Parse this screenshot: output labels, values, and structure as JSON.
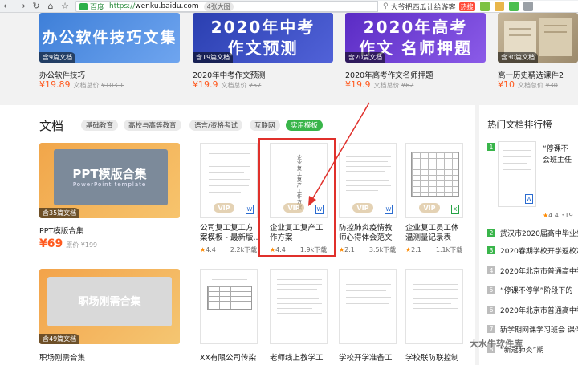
{
  "browser": {
    "back": "←",
    "forward": "→",
    "refresh": "↻",
    "home": "⌂",
    "star": "☆",
    "site_name": "百度",
    "url_prefix": "https://",
    "url_host": "wenku.baidu.com",
    "url_pill": "4张大图",
    "search_text": "大爷把西瓜让给游客",
    "hot_label": "热搜"
  },
  "top_cards": [
    {
      "banner": "办公软件技巧文集",
      "badge": "含9篇文档",
      "title": "办公软件技巧",
      "price": "¥19.89",
      "orig_label": "文档总价",
      "orig_price": "¥103.1"
    },
    {
      "banner": "2020年中考 作文预测",
      "badge": "含19篇文档",
      "title": "2020年中考作文预测",
      "price": "¥19.9",
      "orig_label": "文档总价",
      "orig_price": "¥57"
    },
    {
      "banner": "2020年高考作文 名师押题",
      "badge": "含20篇文档",
      "title": "2020年高考作文名师押题",
      "price": "¥19.9",
      "orig_label": "文档总价",
      "orig_price": "¥62"
    },
    {
      "banner": "",
      "badge": "含30篇文档",
      "title": "高一历史精选课件2",
      "price": "¥10",
      "orig_label": "文档总价",
      "orig_price": "¥30"
    }
  ],
  "section": {
    "title": "文档",
    "tabs": [
      "基础教育",
      "高校与高等教育",
      "语言/资格考试",
      "互联网",
      "实用模板"
    ]
  },
  "row1": {
    "collection": {
      "banner": "PPT模版合集",
      "subtitle": "PowerPoint template",
      "badge": "含35篇文档",
      "title": "PPT模版合集",
      "price": "¥69",
      "orig_label": "原价",
      "orig_price": "¥199"
    },
    "docs": [
      {
        "title_lines": [
          "公司复工复工方",
          "案模板 - 最新版..."
        ],
        "rating": "4.4",
        "downloads": "2.2k下载",
        "vip": "VIP",
        "file": "W"
      },
      {
        "title_lines": [
          "企业复工复产工",
          "作方案"
        ],
        "rating": "4.4",
        "downloads": "1.9k下载",
        "vip": "VIP",
        "file": "W"
      },
      {
        "title_lines": [
          "防控肺炎疫情教",
          "师心得体会范文"
        ],
        "rating": "2.1",
        "downloads": "3.5k下载",
        "vip": "VIP",
        "file": "W"
      },
      {
        "title_lines": [
          "企业复工员工体",
          "温测量记录表"
        ],
        "rating": "2.1",
        "downloads": "1.1k下载",
        "vip": "VIP",
        "file": "X"
      }
    ]
  },
  "row2": {
    "collection": {
      "banner": "职场刚需合集",
      "badge": "含49篇文档",
      "title": "职场刚需合集"
    },
    "docs": [
      {
        "title": "XX有限公司传染"
      },
      {
        "title": "老师线上教学工"
      },
      {
        "title": "学校开学准备工"
      },
      {
        "title": "学校联防联控制"
      }
    ]
  },
  "sidebar": {
    "title": "热门文档排行榜",
    "items": [
      {
        "rank": "1",
        "text": "“停课不"
      },
      {
        "rank": "",
        "text": "会班主任"
      },
      {
        "rank": "",
        "text": "4.4 319"
      },
      {
        "rank": "2",
        "text": "武汉市2020届高中毕业生"
      },
      {
        "rank": "3",
        "text": "2020春期学校开学返校准"
      },
      {
        "rank": "4",
        "text": "2020年北京市普通高中学"
      },
      {
        "rank": "5",
        "text": "“停课不停学”阶段下的"
      },
      {
        "rank": "6",
        "text": "2020年北京市普通高中学"
      },
      {
        "rank": "7",
        "text": "新学期网课学习班会 课件"
      },
      {
        "rank": "8",
        "text": "“新冠肺炎”期"
      }
    ]
  },
  "doc_cover_text": "企业复工复产工作方案",
  "watermark": "大水牛软件库",
  "colors": {
    "accent": "#39b54a",
    "price": "#ff5a1f",
    "highlight": "#e0302b"
  }
}
